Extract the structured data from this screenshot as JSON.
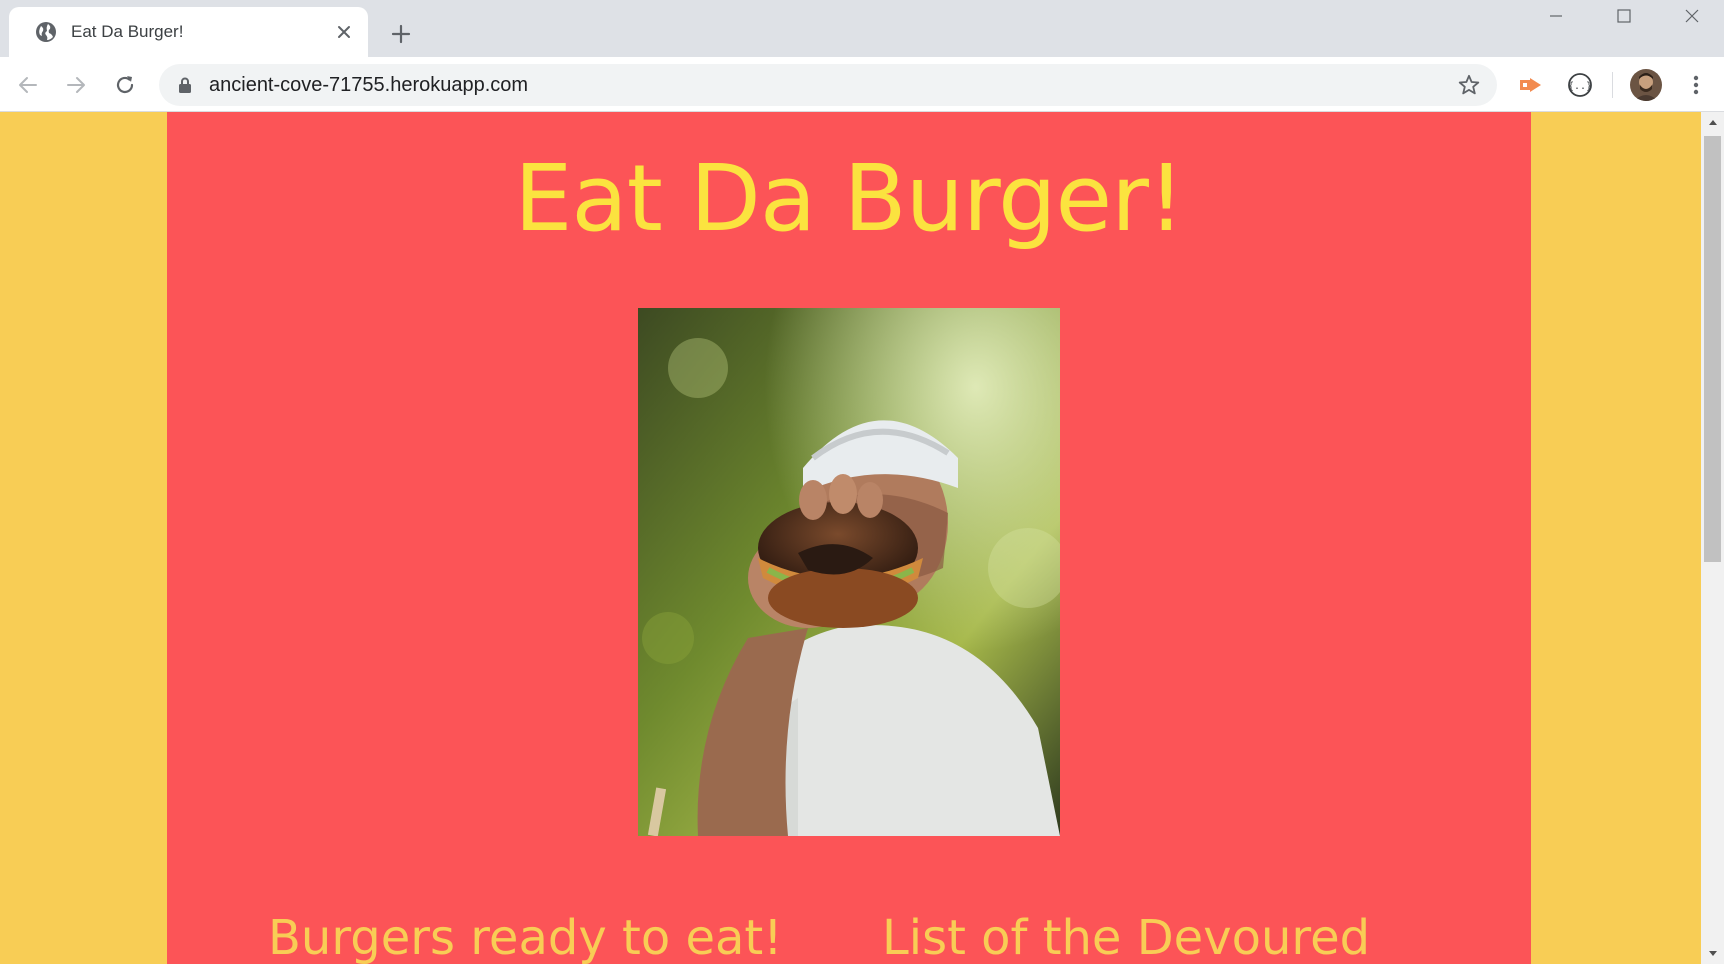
{
  "browser": {
    "tab": {
      "title": "Eat Da Burger!",
      "favicon": "globe-icon"
    },
    "new_tab_icon": "plus-icon",
    "window_controls": [
      "minimize-icon",
      "maximize-icon",
      "close-icon"
    ],
    "address": {
      "url": "ancient-cove-71755.herokuapp.com",
      "secure_icon": "lock-icon"
    },
    "extensions": [
      "cast-extension-icon",
      "json-viewer-extension-icon"
    ],
    "menu_icon": "kebab-menu-icon"
  },
  "page": {
    "title": "Eat Da Burger!",
    "hero_image": "photo of a person holding out a bitten burger",
    "columns": {
      "ready": "Burgers ready to eat!",
      "devoured": "List of the Devoured"
    }
  },
  "colors": {
    "page_background": "#f8cd55",
    "container_background": "#fc5457",
    "title_color": "#fbe33f",
    "column_title_color": "#f8cd55"
  }
}
